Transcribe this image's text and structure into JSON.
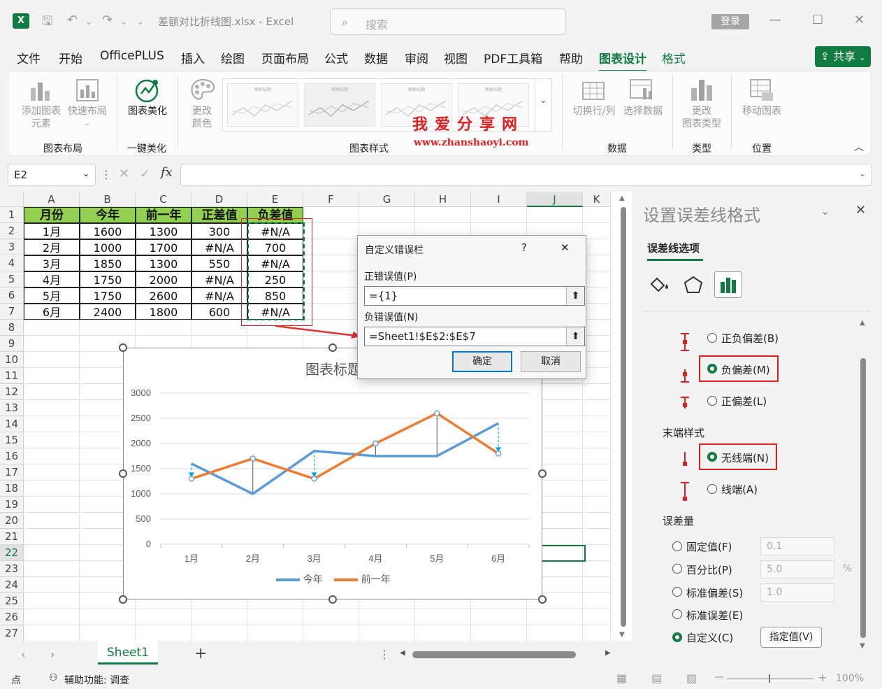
{
  "titlebar": {
    "app_icon": "X",
    "filename": "差额对比折线图.xlsx",
    "separator": "-",
    "app": "Excel",
    "search_placeholder": "搜索",
    "login": "登录"
  },
  "menu": {
    "tabs": [
      "文件",
      "开始",
      "OfficePLUS",
      "插入",
      "绘图",
      "页面布局",
      "公式",
      "数据",
      "审阅",
      "视图",
      "PDF工具箱",
      "帮助",
      "图表设计",
      "格式"
    ],
    "active": "图表设计",
    "share": "共享"
  },
  "ribbon": {
    "add_element": [
      "添加图表",
      "元素"
    ],
    "quick_layout": "快速布局",
    "group_layout": "图表布局",
    "beautify": "图表美化",
    "group_beautify": "一键美化",
    "change_color": [
      "更改",
      "颜色"
    ],
    "group_styles": "图表样式",
    "switch_row_col": "切换行/列",
    "select_data": "选择数据",
    "group_data": "数据",
    "change_type": [
      "更改",
      "图表类型"
    ],
    "group_type": "类型",
    "move_chart": "移动图表",
    "group_location": "位置",
    "thumb_titles": [
      "图表标题",
      "图表标题",
      "图表标题",
      "图表标题"
    ],
    "watermark_cn": "我爱分享网",
    "watermark_url": "www.zhanshaoyi.com"
  },
  "formula_bar": {
    "cell_ref": "E2",
    "fx": "fx",
    "formula": ""
  },
  "sheet": {
    "columns": [
      "A",
      "B",
      "C",
      "D",
      "E",
      "F",
      "G",
      "H",
      "I",
      "J",
      "K"
    ],
    "rows": [
      "1",
      "2",
      "3",
      "4",
      "5",
      "6",
      "7",
      "8",
      "9",
      "10",
      "11",
      "12",
      "13",
      "14",
      "15",
      "16",
      "17",
      "18",
      "19",
      "20",
      "21",
      "22",
      "23",
      "24",
      "25",
      "26",
      "27"
    ],
    "table_headers": [
      "月份",
      "今年",
      "前一年",
      "正差值",
      "负差值"
    ],
    "table_rows": [
      [
        "1月",
        "1600",
        "1300",
        "300",
        "#N/A"
      ],
      [
        "2月",
        "1000",
        "1700",
        "#N/A",
        "700"
      ],
      [
        "3月",
        "1850",
        "1300",
        "550",
        "#N/A"
      ],
      [
        "4月",
        "1750",
        "2000",
        "#N/A",
        "250"
      ],
      [
        "5月",
        "1750",
        "2600",
        "#N/A",
        "850"
      ],
      [
        "6月",
        "2400",
        "1800",
        "600",
        "#N/A"
      ]
    ],
    "tab_name": "Sheet1"
  },
  "chart_data": {
    "type": "line",
    "title": "图表标题",
    "categories": [
      "1月",
      "2月",
      "3月",
      "4月",
      "5月",
      "6月"
    ],
    "series": [
      {
        "name": "今年",
        "values": [
          1600,
          1000,
          1850,
          1750,
          1750,
          2400
        ],
        "color": "#5b9bd5"
      },
      {
        "name": "前一年",
        "values": [
          1300,
          1700,
          1300,
          2000,
          2600,
          1800
        ],
        "color": "#ed7d31"
      }
    ],
    "ylim": [
      0,
      3000
    ],
    "yticks": [
      "0",
      "500",
      "1000",
      "1500",
      "2000",
      "2500",
      "3000"
    ],
    "legend": "bottom",
    "grid": true
  },
  "dialog": {
    "title": "自定义错误栏",
    "help": "?",
    "close": "✕",
    "pos_label": "正错误值(P)",
    "pos_value": "={1}",
    "neg_label": "负错误值(N)",
    "neg_value": "=Sheet1!$E$2:$E$7",
    "ok": "确定",
    "cancel": "取消"
  },
  "pane": {
    "title": "设置误差线格式",
    "tab": "误差线选项",
    "direction": [
      {
        "label": "正负偏差(B)",
        "selected": false
      },
      {
        "label": "负偏差(M)",
        "selected": true
      },
      {
        "label": "正偏差(L)",
        "selected": false
      }
    ],
    "end_style_label": "末端样式",
    "end_style": [
      {
        "label": "无线端(N)",
        "selected": true
      },
      {
        "label": "线端(A)",
        "selected": false
      }
    ],
    "amount_label": "误差量",
    "amount": [
      {
        "label": "固定值(F)",
        "value": "0.1",
        "selected": false
      },
      {
        "label": "百分比(P)",
        "value": "5.0",
        "unit": "%",
        "selected": false
      },
      {
        "label": "标准偏差(S)",
        "value": "1.0",
        "selected": false
      },
      {
        "label": "标准误差(E)",
        "selected": false
      },
      {
        "label": "自定义(C)",
        "selected": true
      }
    ],
    "specify": "指定值(V)"
  },
  "status": {
    "mode": "点",
    "accessibility": "辅助功能: 调查",
    "zoom": "100%"
  }
}
